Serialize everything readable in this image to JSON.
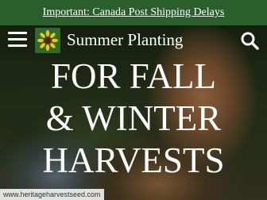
{
  "announcement": {
    "text": "Important: Canada Post Shipping Delays"
  },
  "header": {
    "site_title": "Summer Planting",
    "menu_icon": "hamburger-menu-icon",
    "search_icon": "search-icon",
    "logo_icon": "sunflower-logo-icon"
  },
  "hero": {
    "headline_line1": "FOR FALL",
    "headline_line2": "& WINTER",
    "headline_line3": "HARVESTS",
    "credit": "www.heritageharvestseed.com"
  },
  "colors": {
    "announcement_bg": "#2a5e2d",
    "logo_bg": "#2f6b2a",
    "logo_accent": "#f2c21b",
    "text": "#ffffff"
  }
}
